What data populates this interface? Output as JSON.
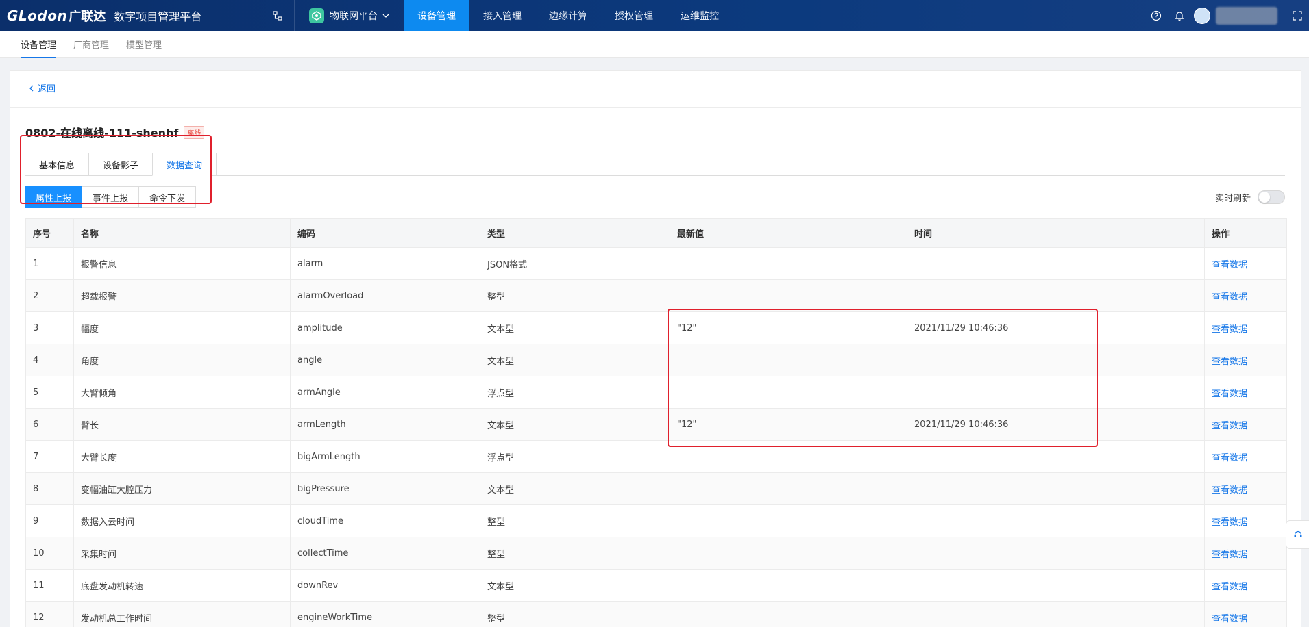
{
  "topbar": {
    "brand": "GLodon",
    "brand_cn": "广联达",
    "app_title": "数字项目管理平台",
    "platform": "物联网平台",
    "nav": [
      {
        "label": "设备管理",
        "active": true
      },
      {
        "label": "接入管理",
        "active": false
      },
      {
        "label": "边缘计算",
        "active": false
      },
      {
        "label": "授权管理",
        "active": false
      },
      {
        "label": "运维监控",
        "active": false
      }
    ],
    "accent": "#0d8af0"
  },
  "subnav": {
    "tabs": [
      {
        "label": "设备管理",
        "active": true
      },
      {
        "label": "厂商管理",
        "active": false
      },
      {
        "label": "模型管理",
        "active": false
      }
    ]
  },
  "page": {
    "back_label": "返回",
    "device_name": "0802-在线离线-111-shenhf",
    "status": "离线",
    "tabs": [
      "基本信息",
      "设备影子",
      "数据查询"
    ],
    "active_tab": "数据查询",
    "sub_tabs": [
      "属性上报",
      "事件上报",
      "命令下发"
    ],
    "active_sub_tab": "属性上报",
    "realtime_label": "实时刷新",
    "realtime_on": false
  },
  "table": {
    "headers": [
      "序号",
      "名称",
      "编码",
      "类型",
      "最新值",
      "时间",
      "操作"
    ],
    "action_label": "查看数据",
    "rows": [
      {
        "no": "1",
        "name": "报警信息",
        "code": "alarm",
        "type": "JSON格式",
        "value": "",
        "time": ""
      },
      {
        "no": "2",
        "name": "超载报警",
        "code": "alarmOverload",
        "type": "整型",
        "value": "",
        "time": ""
      },
      {
        "no": "3",
        "name": "幅度",
        "code": "amplitude",
        "type": "文本型",
        "value": "\"12\"",
        "time": "2021/11/29 10:46:36"
      },
      {
        "no": "4",
        "name": "角度",
        "code": "angle",
        "type": "文本型",
        "value": "",
        "time": ""
      },
      {
        "no": "5",
        "name": "大臂倾角",
        "code": "armAngle",
        "type": "浮点型",
        "value": "",
        "time": ""
      },
      {
        "no": "6",
        "name": "臂长",
        "code": "armLength",
        "type": "文本型",
        "value": "\"12\"",
        "time": "2021/11/29 10:46:36"
      },
      {
        "no": "7",
        "name": "大臂长度",
        "code": "bigArmLength",
        "type": "浮点型",
        "value": "",
        "time": ""
      },
      {
        "no": "8",
        "name": "变幅油缸大腔压力",
        "code": "bigPressure",
        "type": "文本型",
        "value": "",
        "time": ""
      },
      {
        "no": "9",
        "name": "数据入云时间",
        "code": "cloudTime",
        "type": "整型",
        "value": "",
        "time": ""
      },
      {
        "no": "10",
        "name": "采集时间",
        "code": "collectTime",
        "type": "整型",
        "value": "",
        "time": ""
      },
      {
        "no": "11",
        "name": "底盘发动机转速",
        "code": "downRev",
        "type": "文本型",
        "value": "",
        "time": ""
      },
      {
        "no": "12",
        "name": "发动机总工作时间",
        "code": "engineWorkTime",
        "type": "整型",
        "value": "",
        "time": ""
      }
    ]
  }
}
